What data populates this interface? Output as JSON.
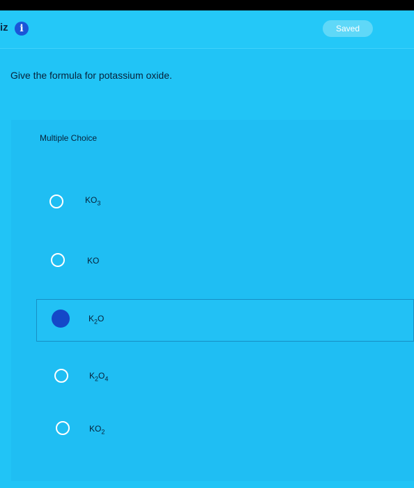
{
  "header": {
    "quiz_label": "iz",
    "info_icon": "info-icon",
    "saved_label": "Saved"
  },
  "question": {
    "text": "Give the formula for potassium oxide."
  },
  "multiple_choice": {
    "label": "Multiple Choice",
    "selected_index": 2,
    "options": [
      {
        "base": "KO",
        "sub": "3",
        "rest": ""
      },
      {
        "base": "KO",
        "sub": "",
        "rest": ""
      },
      {
        "base": "K",
        "sub": "2",
        "rest": "O"
      },
      {
        "base": "K",
        "sub": "2",
        "rest": "O",
        "sub2": "4"
      },
      {
        "base": "KO",
        "sub": "2",
        "rest": ""
      }
    ]
  },
  "colors": {
    "background": "#21c4f6",
    "selected_radio": "#1448c8",
    "header_bar": "#000000"
  }
}
